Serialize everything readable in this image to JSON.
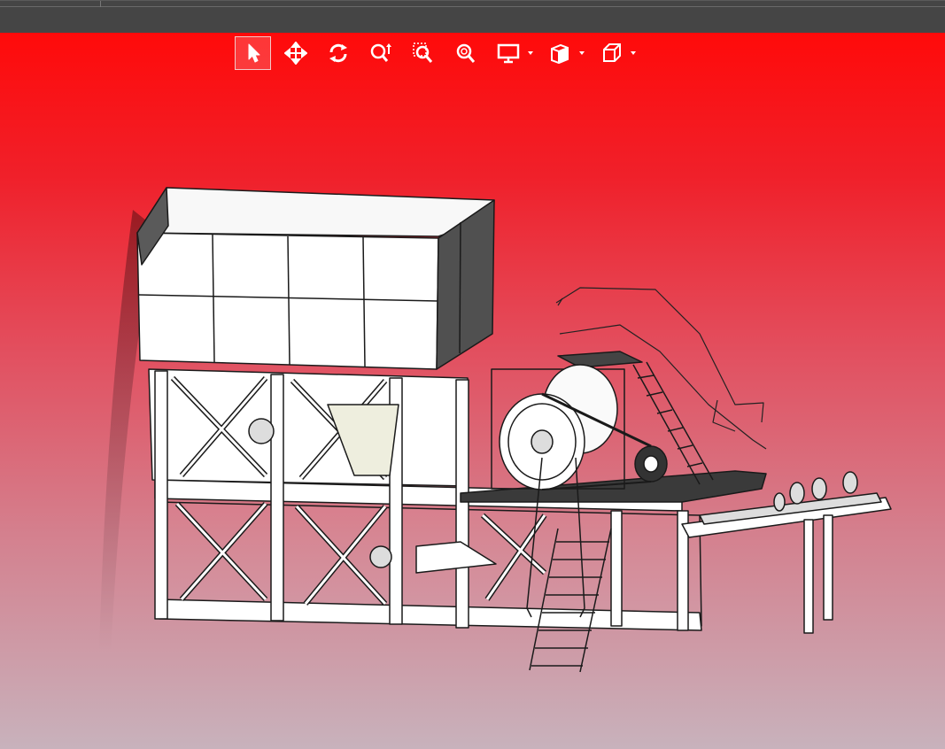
{
  "window": {
    "title": ""
  },
  "viewport": {
    "background_top": "#ff0a0a",
    "background_bottom": "#c8b2bc",
    "model_description_icon": "crusher-plant-3d-model"
  },
  "toolbar": {
    "items": [
      {
        "name": "select",
        "icon": "arrow-cursor-icon",
        "active": true
      },
      {
        "name": "pan",
        "icon": "move-arrows-icon",
        "active": false
      },
      {
        "name": "rotate",
        "icon": "rotate-icon",
        "active": false
      },
      {
        "name": "zoom",
        "icon": "zoom-vertical-icon",
        "active": false
      },
      {
        "name": "zoom-window",
        "icon": "zoom-window-icon",
        "active": false
      },
      {
        "name": "zoom-fit",
        "icon": "zoom-fit-icon",
        "active": false
      },
      {
        "name": "display-mode",
        "icon": "monitor-icon",
        "dropdown": true
      },
      {
        "name": "section-view",
        "icon": "section-view-icon",
        "dropdown": true
      },
      {
        "name": "standard-views",
        "icon": "cube-icon",
        "dropdown": true
      }
    ]
  },
  "colors": {
    "accent_border": "#f3c9c9",
    "icon": "#ffffff",
    "model_line": "#1a1a1a"
  }
}
